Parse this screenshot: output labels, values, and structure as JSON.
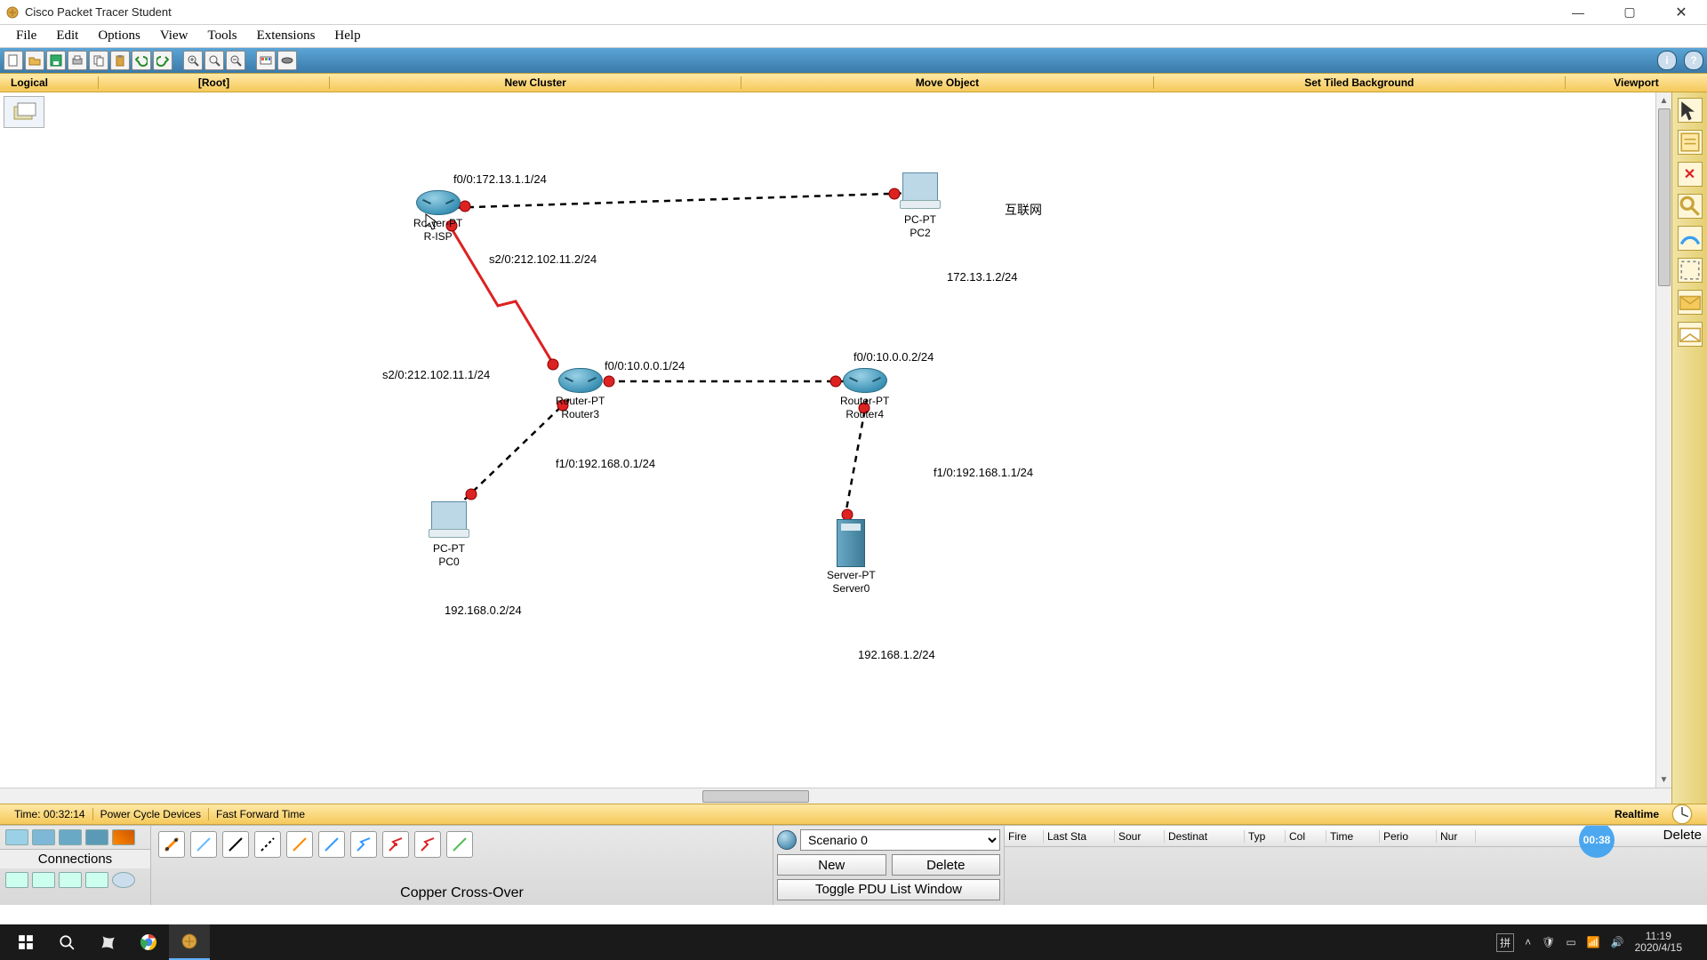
{
  "window": {
    "title": "Cisco Packet Tracer Student",
    "minimize": "—",
    "maximize": "▢",
    "close": "✕"
  },
  "menus": [
    "File",
    "Edit",
    "Options",
    "View",
    "Tools",
    "Extensions",
    "Help"
  ],
  "navbar": {
    "logical": "Logical",
    "root": "[Root]",
    "new_cluster": "New Cluster",
    "move_object": "Move Object",
    "set_bg": "Set Tiled Background",
    "viewport": "Viewport"
  },
  "topology": {
    "devices": {
      "r_isp": {
        "line1": "Router-PT",
        "line2": "R-ISP"
      },
      "router3": {
        "line1": "Router-PT",
        "line2": "Router3"
      },
      "router4": {
        "line1": "Router-PT",
        "line2": "Router4"
      },
      "pc2": {
        "line1": "PC-PT",
        "line2": "PC2"
      },
      "pc0": {
        "line1": "PC-PT",
        "line2": "PC0"
      },
      "server0": {
        "line1": "Server-PT",
        "line2": "Server0"
      }
    },
    "labels": {
      "internet_tag": "互联网",
      "f00_risp": "f0/0:172.13.1.1/24",
      "s20_risp": "s2/0:212.102.11.2/24",
      "s20_r3": "s2/0:212.102.11.1/24",
      "f00_r3": "f0/0:10.0.0.1/24",
      "f00_r4": "f0/0:10.0.0.2/24",
      "f10_r3": "f1/0:192.168.0.1/24",
      "f10_r4": "f1/0:192.168.1.1/24",
      "pc2_ip": "172.13.1.2/24",
      "pc0_ip": "192.168.0.2/24",
      "srv_ip": "192.168.1.2/24"
    }
  },
  "timebar": {
    "time_label": "Time: ",
    "time_value": "00:32:14",
    "power_cycle": "Power Cycle Devices",
    "ffwd": "Fast Forward Time",
    "realtime": "Realtime"
  },
  "bottom": {
    "connections_label": "Connections",
    "mid_status": "Copper Cross-Over",
    "badge": "00:38",
    "scenario_value": "Scenario 0",
    "new_btn": "New",
    "delete_btn": "Delete",
    "pdu_btn": "Toggle PDU List Window",
    "table_headers": [
      "Fire",
      "Last Sta",
      "Sour",
      "Destinat",
      "Typ",
      "Col",
      "Time",
      "Perio",
      "Nur"
    ],
    "table_delete": "Delete"
  },
  "system": {
    "clock_time": "11:19",
    "clock_date": "2020/4/15",
    "ime": "拼"
  }
}
